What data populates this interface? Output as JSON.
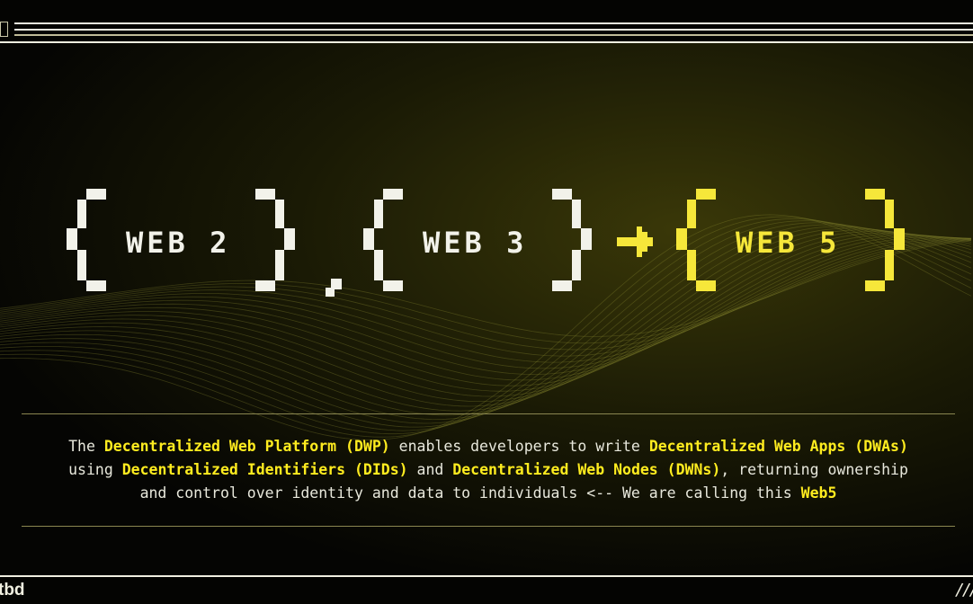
{
  "header": {
    "labels": [
      {
        "text": "WEB 2",
        "color": "#f2f2ea"
      },
      {
        "text": "WEB 3",
        "color": "#f2f2ea"
      },
      {
        "text": "WEB 5",
        "color": "#f6e73a"
      }
    ],
    "separator": ",",
    "arrow_icon": "right-arrow"
  },
  "description": {
    "lines": [
      [
        {
          "t": "The ",
          "h": false
        },
        {
          "t": "Decentralized Web Platform (DWP)",
          "h": true
        },
        {
          "t": " enables developers to write ",
          "h": false
        },
        {
          "t": "Decentralized Web Apps (DWAs)",
          "h": true
        }
      ],
      [
        {
          "t": "using ",
          "h": false
        },
        {
          "t": "Decentralized Identifiers (DIDs)",
          "h": true
        },
        {
          "t": " and ",
          "h": false
        },
        {
          "t": "Decentralized Web Nodes (DWNs)",
          "h": true
        },
        {
          "t": ", returning ownership",
          "h": false
        }
      ],
      [
        {
          "t": "and control over identity and data to individuals <-- We are calling this ",
          "h": false
        },
        {
          "t": "Web5",
          "h": true
        }
      ]
    ]
  },
  "footer": {
    "logo": "tbd",
    "mark": "///"
  },
  "colors": {
    "accent": "#ffec1f",
    "text": "#e8e8dc",
    "background": "#040402"
  }
}
